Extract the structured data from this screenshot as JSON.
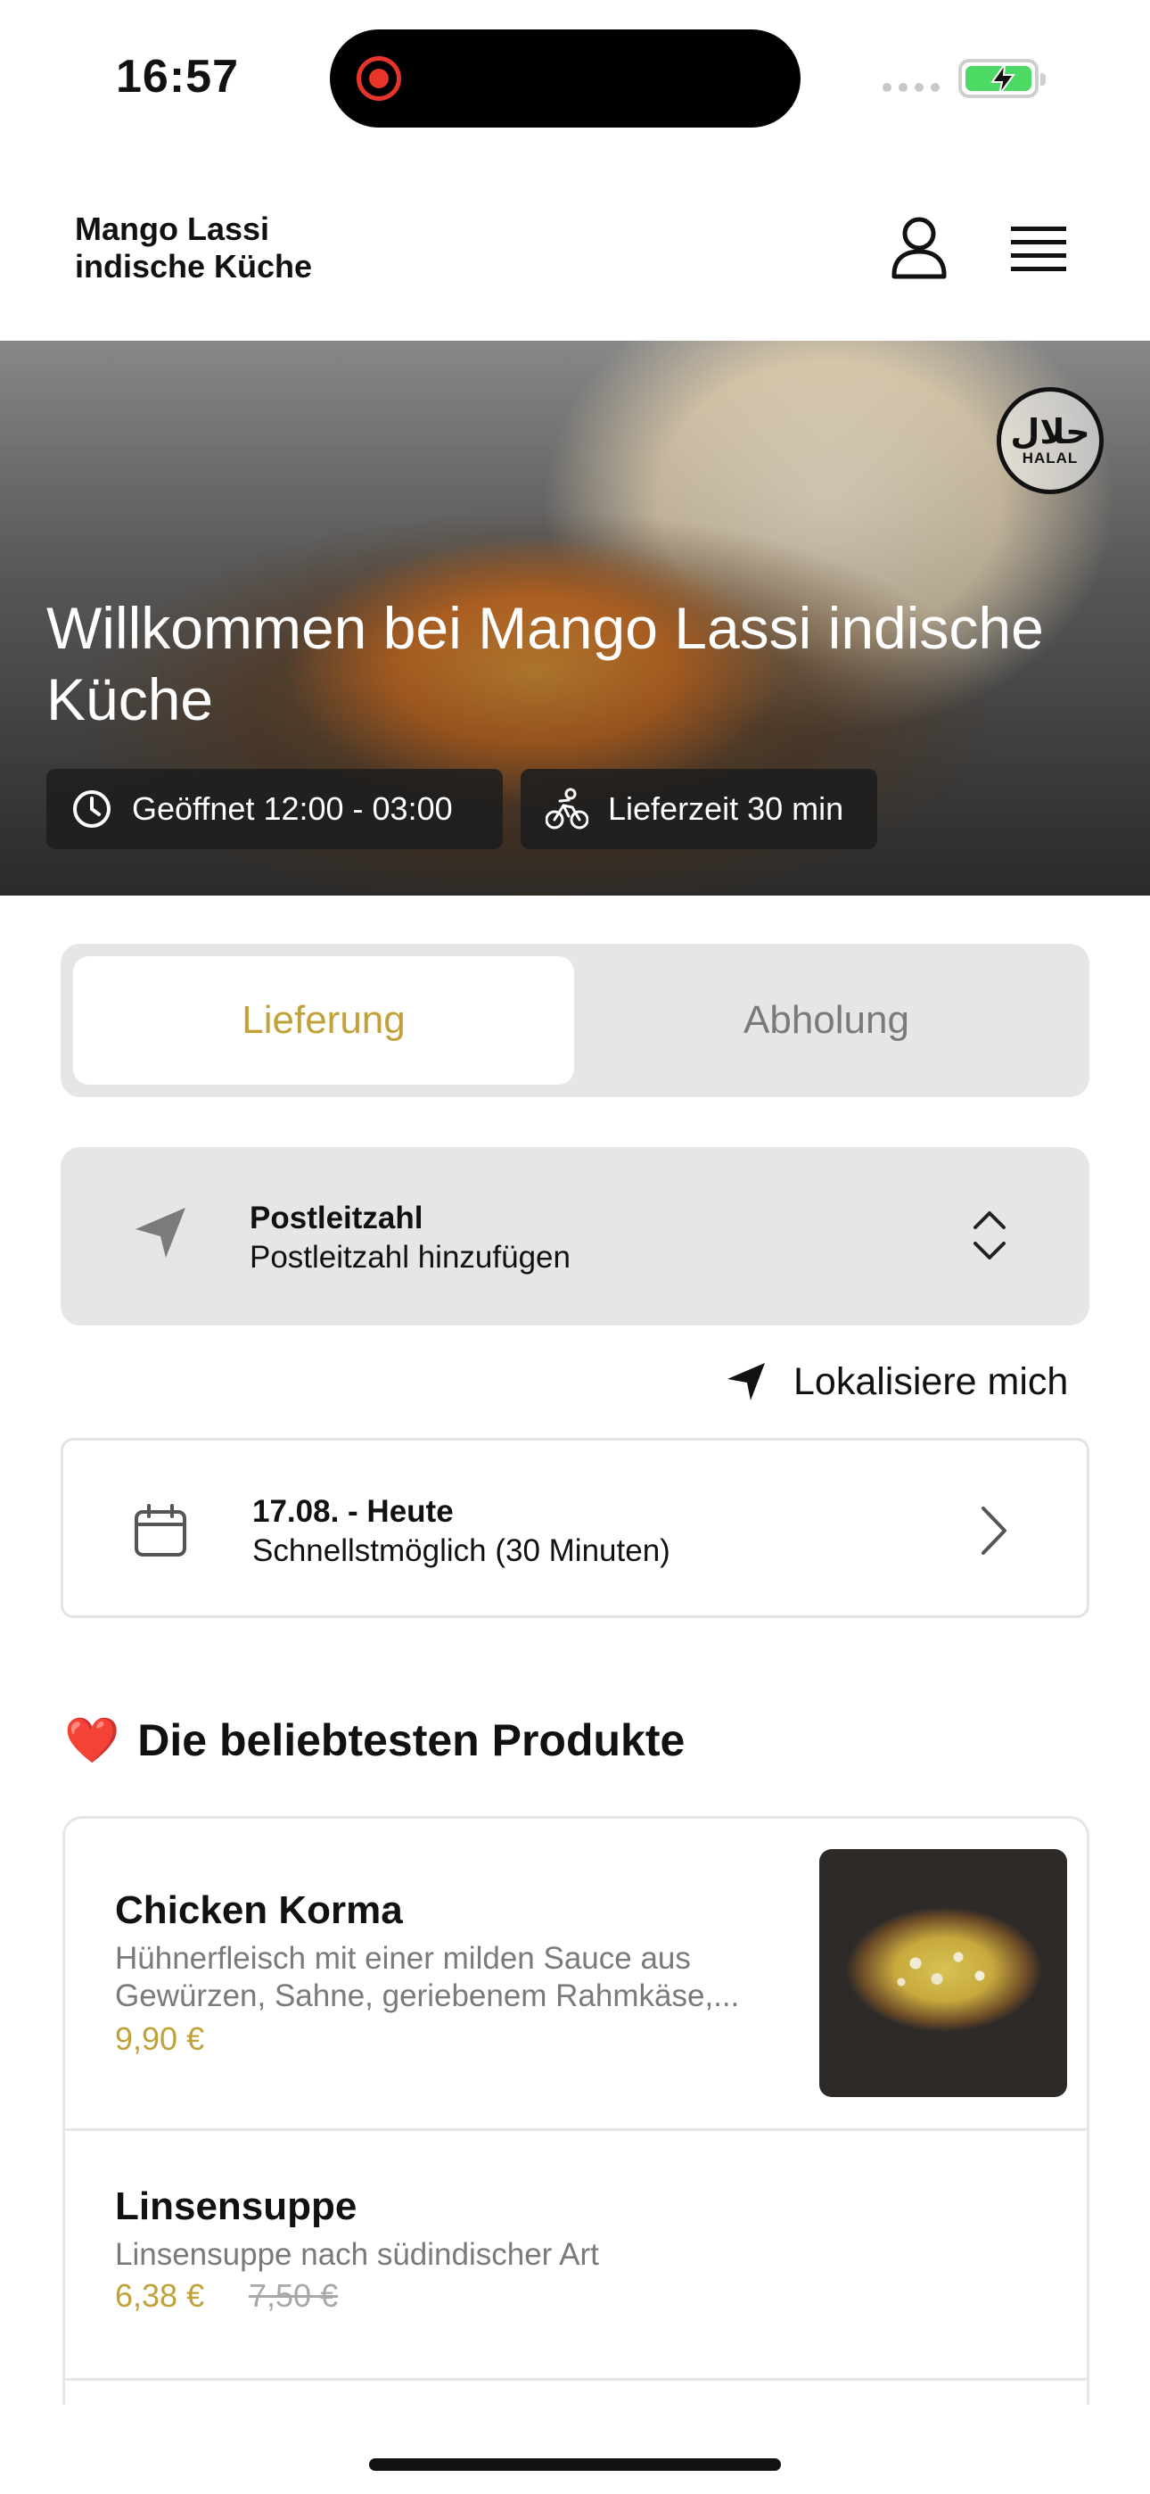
{
  "status_bar": {
    "time": "16:57"
  },
  "header": {
    "brand_line1": "Mango Lassi",
    "brand_line2": "indische Küche",
    "user_icon": "person-icon",
    "menu_icon": "hamburger-menu-icon"
  },
  "hero": {
    "title": "Willkommen bei Mango Lassi indische Küche",
    "badge_arabic": "حلال",
    "badge_text": "HALAL",
    "opening_hours": "Geöffnet 12:00 - 03:00",
    "delivery_time": "Lieferzeit 30 min"
  },
  "order_mode": {
    "delivery_label": "Lieferung",
    "pickup_label": "Abholung",
    "selected": "Lieferung"
  },
  "postcode": {
    "label": "Postleitzahl",
    "placeholder": "Postleitzahl hinzufügen"
  },
  "locate_label": "Lokalisiere mich",
  "schedule": {
    "date": "17.08. - Heute",
    "time": "Schnellstmöglich (30 Minuten)"
  },
  "popular": {
    "emoji": "❤️",
    "title": "Die beliebtesten Produkte",
    "items": [
      {
        "name": "Chicken Korma",
        "description_line1": "Hühnerfleisch mit einer milden Sauce aus",
        "description_line2": "Gewürzen, Sahne, geriebenem Rahmkäse,...",
        "price": "9,90 €"
      },
      {
        "name": "Linsensuppe",
        "description_line1": "Linsensuppe nach südindischer Art",
        "price": "6,38 €",
        "old_price": "7,50 €"
      }
    ]
  },
  "colors": {
    "accent_gold": "#c0a13a",
    "panel_gray": "#e6e6e6",
    "battery_green": "#4cd964"
  }
}
